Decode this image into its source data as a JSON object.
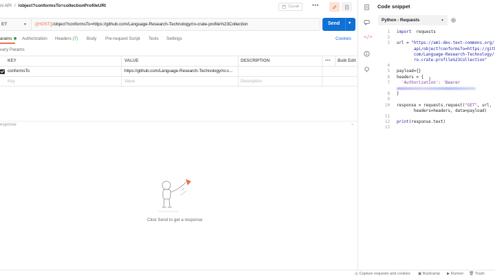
{
  "header": {
    "collection": "ni API",
    "separator": "/",
    "request_name": "/object?conformsTo=collectionProfileURI",
    "save_label": "Save"
  },
  "request": {
    "method": "ET",
    "url_var": "{{HOST}}",
    "url_rest": "/object?conformsTo=https://github.com/Language-Research-Technology/ro-crate-profile%23Collection",
    "send_label": "Send"
  },
  "tabs": [
    {
      "label": "arams"
    },
    {
      "label": "Authorization"
    },
    {
      "label": "Headers",
      "count": "(7)"
    },
    {
      "label": "Body"
    },
    {
      "label": "Pre-request Script"
    },
    {
      "label": "Tests"
    },
    {
      "label": "Settings"
    }
  ],
  "cookies_label": "Cookies",
  "query_params_title": "uery Params",
  "params_table": {
    "headers": {
      "key": "KEY",
      "value": "VALUE",
      "description": "DESCRIPTION",
      "bulk": "Bulk Edit",
      "more": "•••"
    },
    "rows": [
      {
        "key": "conformsTo",
        "value": "https://github.com/Language-Research-Technology/ro-c..."
      }
    ],
    "placeholders": {
      "key": "Key",
      "value": "Value",
      "description": "Description"
    }
  },
  "response": {
    "label": "esponse",
    "empty_message": "Click Send to get a response"
  },
  "code_snippet": {
    "title": "Code snippet",
    "language": "Python - Requests",
    "lines": [
      {
        "n": "1",
        "segs": [
          [
            "kw",
            "import"
          ],
          [
            "",
            "  requests"
          ]
        ]
      },
      {
        "n": "2",
        "segs": []
      },
      {
        "n": "3",
        "segs": [
          [
            "",
            "url = "
          ],
          [
            "str",
            "\"https://ami-dev.text-commons.org/"
          ]
        ]
      },
      {
        "n": "",
        "segs": [
          [
            "str",
            "       api/object?conformsTo=https://github."
          ]
        ]
      },
      {
        "n": "",
        "segs": [
          [
            "str",
            "       com/Language-Research-Technology/"
          ]
        ]
      },
      {
        "n": "",
        "segs": [
          [
            "str",
            "       ro-crate-profile%23Collection\""
          ]
        ]
      },
      {
        "n": "4",
        "segs": []
      },
      {
        "n": "5",
        "segs": [
          [
            "",
            "payload={}"
          ]
        ]
      },
      {
        "n": "6",
        "segs": [
          [
            "",
            "headers = {"
          ]
        ]
      },
      {
        "n": "7",
        "segs": [
          [
            "strp",
            "  'Authorization'"
          ],
          [
            "",
            ": "
          ],
          [
            "strp",
            "'Bearer"
          ]
        ]
      },
      {
        "n": "",
        "segs": [
          [
            "blur",
            ""
          ]
        ]
      },
      {
        "n": "8",
        "segs": [
          [
            "",
            "}"
          ]
        ]
      },
      {
        "n": "9",
        "segs": []
      },
      {
        "n": "10",
        "segs": [
          [
            "",
            "response = requests.request("
          ],
          [
            "strp",
            "\"GET\""
          ],
          [
            "",
            ", url,"
          ]
        ]
      },
      {
        "n": "",
        "segs": [
          [
            "",
            "       headers=headers, data=payload)"
          ]
        ]
      },
      {
        "n": "11",
        "segs": []
      },
      {
        "n": "12",
        "segs": [
          [
            "kw",
            "print"
          ],
          [
            "",
            "(response.text)"
          ]
        ]
      },
      {
        "n": "13",
        "segs": []
      }
    ]
  },
  "status_bar": {
    "capture": "Capture requests and cookies",
    "bootcamp": "Bootcamp",
    "runner": "Runner",
    "trash": "Trash"
  },
  "colors": {
    "send": "#0f70d6",
    "accent": "#e8704d",
    "active_dot": "#28a745"
  }
}
